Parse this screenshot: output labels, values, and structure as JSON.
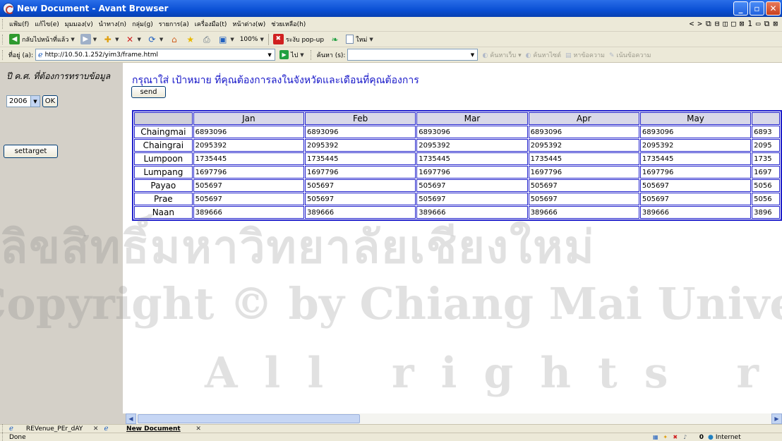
{
  "window": {
    "title": "New Document - Avant Browser",
    "minimize": "_",
    "maximize": "▫",
    "close": "✕"
  },
  "menu": {
    "items": [
      "แฟ้ม(f)",
      "แก้ไข(e)",
      "มุมมอง(v)",
      "นำทาง(n)",
      "กลุ่ม(g)",
      "รายการ(a)",
      "เครื่องมือ(t)",
      "หน้าต่าง(w)",
      "ช่วยเหลือ(h)"
    ],
    "nav_glyphs": [
      "<",
      ">",
      "⧉",
      "⊟",
      "◫",
      "□",
      "⊠",
      "1",
      "▭",
      "⧉",
      "⊠"
    ]
  },
  "toolbar": {
    "back_label": "กลับไปหน้าที่แล้ว",
    "zoom": "100%",
    "popup_label": "ระงับ pop-up",
    "new_label": "ใหม่"
  },
  "addressbar": {
    "label": "ที่อยู่ (a):",
    "url": "http://10.50.1.252/yim3/frame.html",
    "go_label": "ไป",
    "search_label": "ค้นหา (s):",
    "search_value": "",
    "search_links": [
      "ค้นหาเว็บ",
      "ค้นหาไซต์",
      "หาข้อความ",
      "เน้นข้อความ"
    ]
  },
  "leftpane": {
    "year_prompt": "ปี ค.ศ. ที่ต้องการทราบข้อมูล",
    "year_value": "2006",
    "ok_label": "OK",
    "settarget_label": "settarget"
  },
  "main": {
    "instruction": "กรุณาใส่ เป้าหมาย ที่คุณต้องการลงในจังหวัดและเดือนที่คุณต้องการ",
    "send_label": "send",
    "table": {
      "months": [
        "Jan",
        "Feb",
        "Mar",
        "Apr",
        "May",
        ""
      ],
      "rows": [
        {
          "province": "Chaingmai",
          "values": [
            "6893096",
            "6893096",
            "6893096",
            "6893096",
            "6893096",
            "6893"
          ]
        },
        {
          "province": "Chaingrai",
          "values": [
            "2095392",
            "2095392",
            "2095392",
            "2095392",
            "2095392",
            "2095"
          ]
        },
        {
          "province": "Lumpoon",
          "values": [
            "1735445",
            "1735445",
            "1735445",
            "1735445",
            "1735445",
            "1735"
          ]
        },
        {
          "province": "Lumpang",
          "values": [
            "1697796",
            "1697796",
            "1697796",
            "1697796",
            "1697796",
            "1697"
          ]
        },
        {
          "province": "Payao",
          "values": [
            "505697",
            "505697",
            "505697",
            "505697",
            "505697",
            "5056"
          ]
        },
        {
          "province": "Prae",
          "values": [
            "505697",
            "505697",
            "505697",
            "505697",
            "505697",
            "5056"
          ]
        },
        {
          "province": "Naan",
          "values": [
            "389666",
            "389666",
            "389666",
            "389666",
            "389666",
            "3896"
          ]
        }
      ]
    }
  },
  "watermark": {
    "line1": "ลิขสิทธิ์มหาวิทยาลัยเชียงใหม่",
    "line2": "Copyright © by Chiang Mai University",
    "line3": "All rights reserved"
  },
  "tabs": [
    {
      "label": "REVenue_PEr_dAY",
      "active": false
    },
    {
      "label": "New Document",
      "active": true
    }
  ],
  "statusbar": {
    "status": "Done",
    "count": "0",
    "zone": "Internet"
  }
}
